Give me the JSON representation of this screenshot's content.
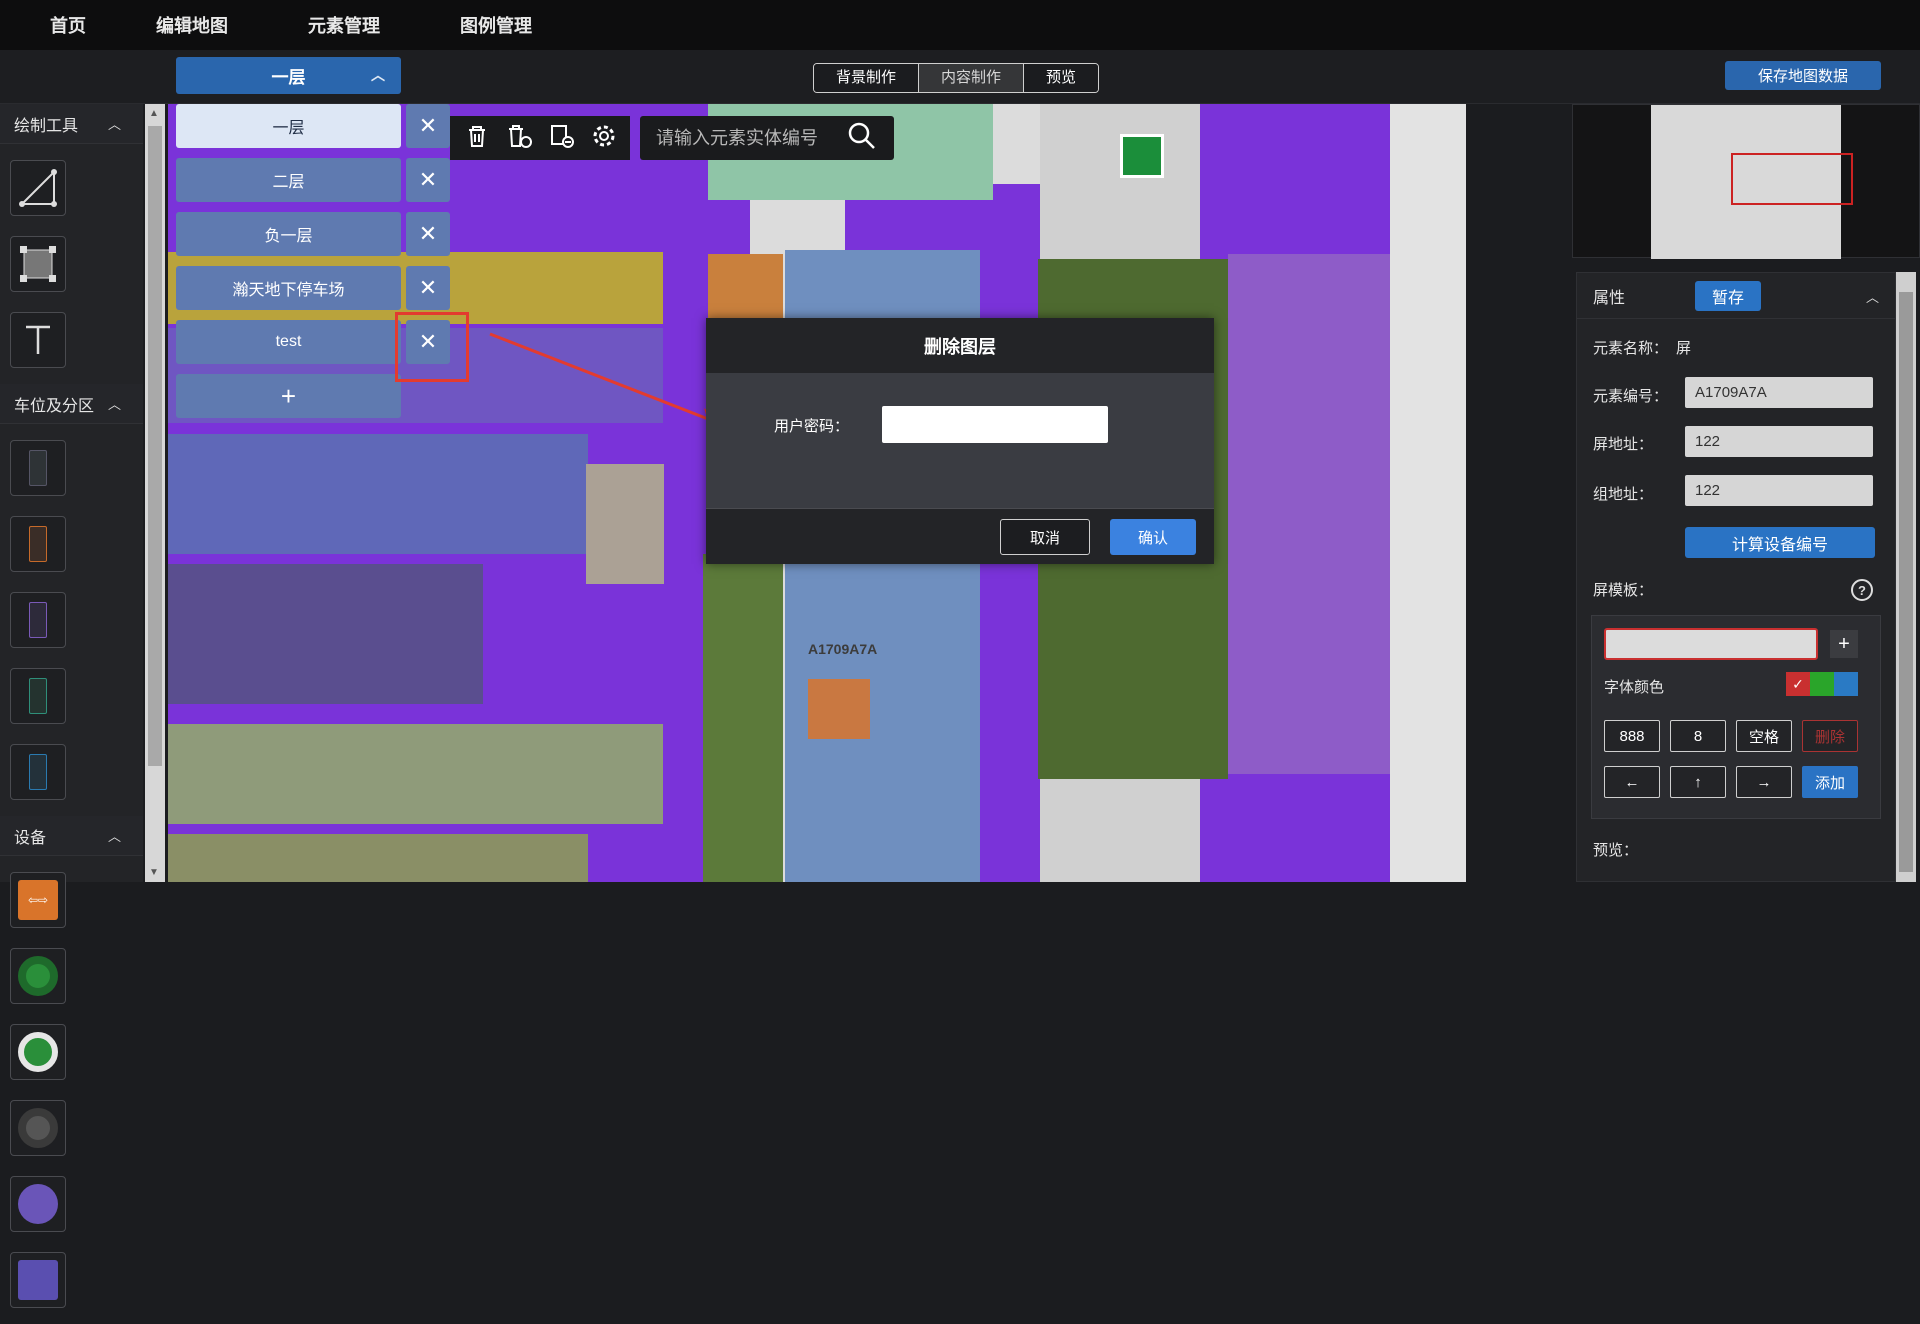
{
  "nav": {
    "items": [
      "首页",
      "编辑地图",
      "元素管理",
      "图例管理"
    ]
  },
  "floor_selector": {
    "label": "一层"
  },
  "mode_tabs": {
    "items": [
      "背景制作",
      "内容制作",
      "预览"
    ],
    "active": "内容制作"
  },
  "save_button": "保存地图数据",
  "left_panel": {
    "draw_tools_title": "绘制工具",
    "parking_title": "车位及分区",
    "device_title": "设备"
  },
  "layers": {
    "items": [
      "一层",
      "二层",
      "负一层",
      "瀚天地下停车场",
      "test"
    ],
    "active": "一层",
    "add_label": "+"
  },
  "search": {
    "placeholder": "请输入元素实体编号"
  },
  "dialog": {
    "title": "删除图层",
    "password_label": "用户密码：",
    "password_value": "",
    "cancel_label": "取消",
    "confirm_label": "确认"
  },
  "map": {
    "element_label": "A1709A7A"
  },
  "properties": {
    "title": "属性",
    "stash_label": "暂存",
    "element_name_label": "元素名称：",
    "element_name": "屏",
    "element_code_label": "元素编号：",
    "element_code": "A1709A7A",
    "screen_addr_label": "屏地址：",
    "screen_addr": "122",
    "group_addr_label": "组地址：",
    "group_addr": "122",
    "calc_button": "计算设备编号",
    "template_label": "屏模板：",
    "font_color_label": "字体颜色",
    "keys": [
      "888",
      "8",
      "空格",
      "删除",
      "←",
      "↑",
      "→",
      "添加"
    ],
    "preview_label": "预览："
  },
  "colors": {
    "accent": "#2a66ad",
    "map_purple": "#7a33d9",
    "alert_red": "#e33b2f"
  }
}
